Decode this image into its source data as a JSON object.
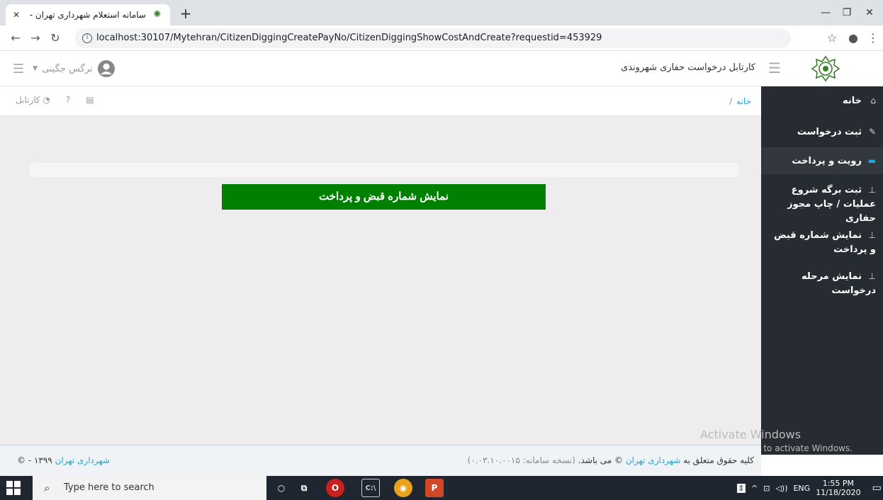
{
  "browser": {
    "tab_title": "سامانه استعلام شهرداری تهران - ",
    "url": "localhost:30107/Mytehran/CitizenDiggingCreatePayNo/CitizenDiggingShowCostAndCreate?requestid=453929"
  },
  "header": {
    "title": "کارتابل درخواست حفاری شهروندی",
    "user_name": "نرگس جگینی"
  },
  "breadcrumb": {
    "home": "خانه",
    "sep": "/"
  },
  "toolbar": {
    "kartabl_label": "کارتابل"
  },
  "sidebar": {
    "items": [
      {
        "label": "خانه",
        "icon": "home-icon"
      },
      {
        "label": "ثبت درخواست",
        "icon": "edit-icon"
      },
      {
        "label": "رویت و پرداخت",
        "icon": "folder-icon",
        "active": true
      },
      {
        "label": "ثبت برگه شروع عملیات / چاپ مجوز حفاری",
        "icon": "upload-icon"
      },
      {
        "label": "نمایش شماره قبض و پرداخت",
        "icon": "upload-icon"
      },
      {
        "label": "نمایش مرحله درخواست",
        "icon": "upload-icon"
      }
    ]
  },
  "main": {
    "button_label": "نمایش شماره قبض و پرداخت"
  },
  "footer": {
    "left_brand": "شهرداری تهران",
    "left_rest": "© - ۱۳۹۹",
    "right_prefix": "کلیه حقوق متعلق به",
    "right_brand": "شهرداری تهران",
    "right_suffix": "© می باشد.",
    "version": "(نسخه سامانه: ۰.۰۳.۱۰.۰۰۱۵)"
  },
  "watermark": {
    "line1": "Activate Windows",
    "line2": "Go to Settings to activate Windows."
  },
  "taskbar": {
    "search_placeholder": "Type here to search",
    "lang": "ENG",
    "time": "1:55 PM",
    "date": "11/18/2020"
  },
  "colors": {
    "accent": "#20a8d8",
    "button": "#008000",
    "sidebar": "#272c33"
  }
}
